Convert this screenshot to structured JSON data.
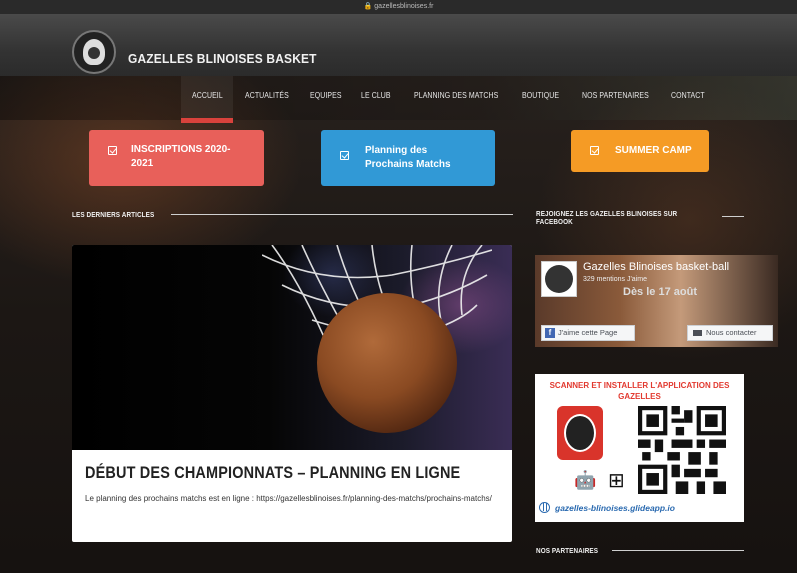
{
  "browser": {
    "url": "gazellesblinoises.fr"
  },
  "site": {
    "title": "GAZELLES BLINOISES BASKET"
  },
  "nav": {
    "items": [
      {
        "label": "ACCUEIL",
        "active": true
      },
      {
        "label": "ACTUALITÉS"
      },
      {
        "label": "EQUIPES"
      },
      {
        "label": "LE CLUB"
      },
      {
        "label": "PLANNING DES MATCHS"
      },
      {
        "label": "BOUTIQUE"
      },
      {
        "label": "NOS PARTENAIRES"
      },
      {
        "label": "CONTACT"
      }
    ]
  },
  "cta": {
    "inscriptions": "INSCRIPTIONS 2020-2021",
    "planning": "Planning des Prochains Matchs",
    "summer": "SUMMER CAMP"
  },
  "articles": {
    "heading": "LES DERNIERS ARTICLES",
    "featured": {
      "title": "DÉBUT DES CHAMPIONNATS – PLANNING EN LIGNE",
      "excerpt": "Le planning des prochains matchs est en ligne : https://gazellesblinoises.fr/planning-des-matchs/prochains-matchs/"
    }
  },
  "facebook": {
    "heading": "REJOIGNEZ LES GAZELLES BLINOISES SUR FACEBOOK",
    "page_name": "Gazelles Blinoises basket-ball",
    "members": "329 mentions J'aime",
    "event_text": "Dès le 17 août",
    "like_button": "J'aime cette Page",
    "contact_button": "Nous contacter"
  },
  "app_promo": {
    "title": "SCANNER ET INSTALLER L'APPLICATION DES GAZELLES",
    "url": "gazelles-blinoises.glideapp.io"
  },
  "partners": {
    "heading": "NOS PARTENAIRES"
  },
  "colors": {
    "accent_red": "#e8605a",
    "accent_blue": "#3199d6",
    "accent_orange": "#f59b25",
    "nav_active": "#d9423c"
  }
}
